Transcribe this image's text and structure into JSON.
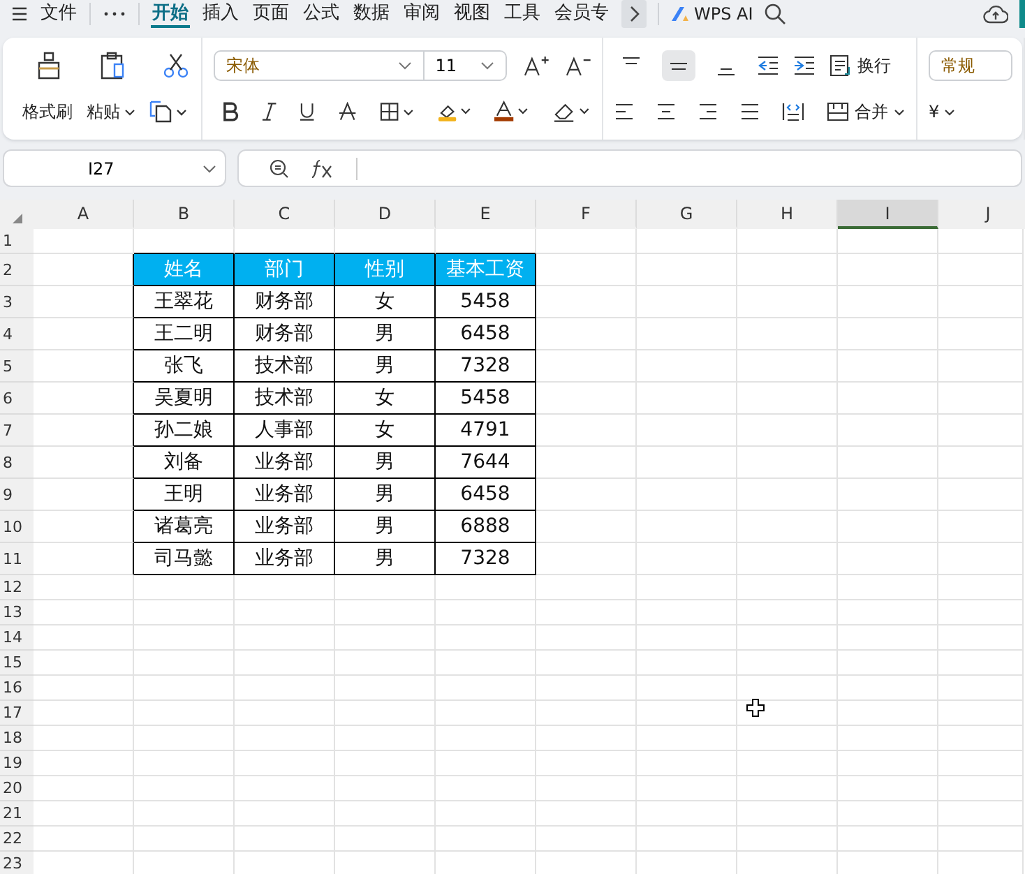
{
  "menu": {
    "tabs": [
      {
        "label": "文件",
        "selected": false
      },
      {
        "label": "开始",
        "selected": true
      },
      {
        "label": "插入",
        "selected": false
      },
      {
        "label": "页面",
        "selected": false
      },
      {
        "label": "公式",
        "selected": false
      },
      {
        "label": "数据",
        "selected": false
      },
      {
        "label": "审阅",
        "selected": false
      },
      {
        "label": "视图",
        "selected": false
      },
      {
        "label": "工具",
        "selected": false
      },
      {
        "label": "会员专",
        "selected": false
      }
    ],
    "ai_label": "WPS AI"
  },
  "ribbon": {
    "format_painter": "格式刷",
    "paste": "粘贴",
    "font": "宋体",
    "font_size": "11",
    "wrap": "换行",
    "merge": "合并",
    "number_format": "常规",
    "currency": "¥",
    "vertical_align": [
      {
        "kind": "top",
        "selected": false
      },
      {
        "kind": "middle",
        "selected": true
      },
      {
        "kind": "bottom",
        "selected": false
      }
    ]
  },
  "name_box": "I27",
  "sheet": {
    "columns": [
      {
        "label": "A",
        "selected": false
      },
      {
        "label": "B",
        "selected": false
      },
      {
        "label": "C",
        "selected": false
      },
      {
        "label": "D",
        "selected": false
      },
      {
        "label": "E",
        "selected": false
      },
      {
        "label": "F",
        "selected": false
      },
      {
        "label": "G",
        "selected": false
      },
      {
        "label": "H",
        "selected": false
      },
      {
        "label": "I",
        "selected": true
      },
      {
        "label": "J",
        "selected": false
      }
    ],
    "row_labels": [
      "1",
      "2",
      "3",
      "4",
      "5",
      "6",
      "7",
      "8",
      "9",
      "10",
      "11",
      "12",
      "13",
      "14",
      "15",
      "16",
      "17",
      "18",
      "19",
      "20",
      "21",
      "22",
      "23"
    ],
    "table": {
      "header": [
        "姓名",
        "部门",
        "性别",
        "基本工资"
      ],
      "rows": [
        [
          "王翠花",
          "财务部",
          "女",
          "5458"
        ],
        [
          "王二明",
          "财务部",
          "男",
          "6458"
        ],
        [
          "张飞",
          "技术部",
          "男",
          "7328"
        ],
        [
          "吴夏明",
          "技术部",
          "女",
          "5458"
        ],
        [
          "孙二娘",
          "人事部",
          "女",
          "4791"
        ],
        [
          "刘备",
          "业务部",
          "男",
          "7644"
        ],
        [
          "王明",
          "业务部",
          "男",
          "6458"
        ],
        [
          "诸葛亮",
          "业务部",
          "男",
          "6888"
        ],
        [
          "司马懿",
          "业务部",
          "男",
          "7328"
        ]
      ]
    }
  }
}
